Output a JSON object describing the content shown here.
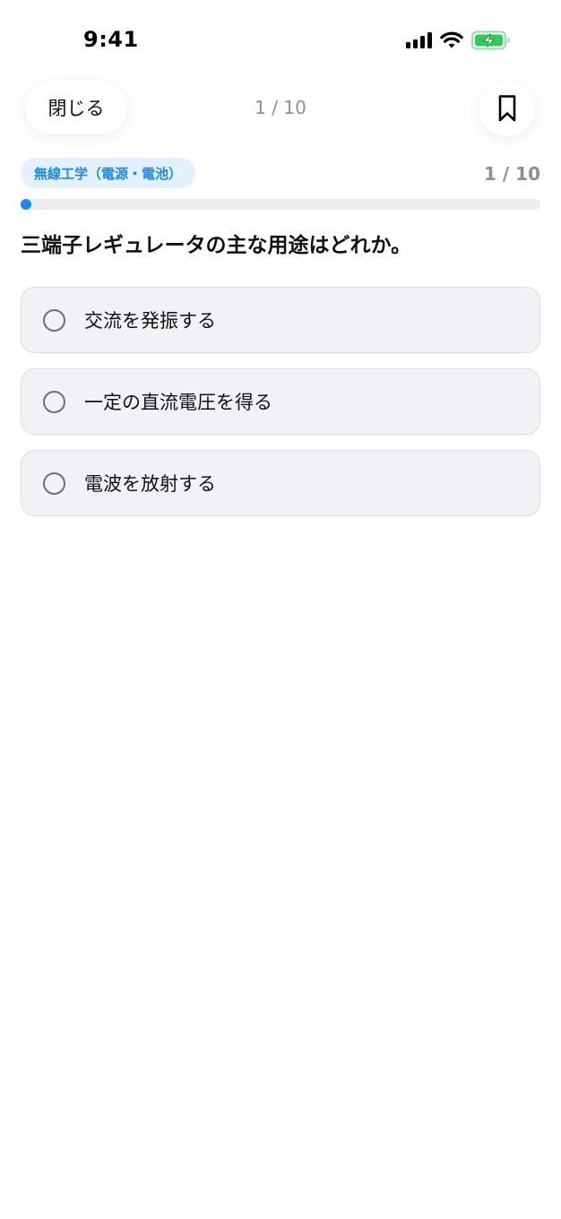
{
  "status_bar": {
    "time": "9:41",
    "icons": [
      "cellular-signal-icon",
      "wifi-icon",
      "battery-charging-icon"
    ],
    "battery_color": "#34c759"
  },
  "nav": {
    "close_label": "閉じる",
    "counter": "1 / 10",
    "bookmark_icon": "bookmark-icon"
  },
  "quiz": {
    "category": "無線工学（電源・電池）",
    "progress_label": "1 / 10",
    "current": 1,
    "total": 10,
    "question": "三端子レギュレータの主な用途はどれか。",
    "options": [
      {
        "label": "交流を発振する"
      },
      {
        "label": "一定の直流電圧を得る"
      },
      {
        "label": "電波を放射する"
      }
    ]
  },
  "colors": {
    "accent": "#1e88f0",
    "badge_background": "#e3f0fd",
    "badge_text": "#1f87e5",
    "option_background": "#f2f2f6"
  }
}
